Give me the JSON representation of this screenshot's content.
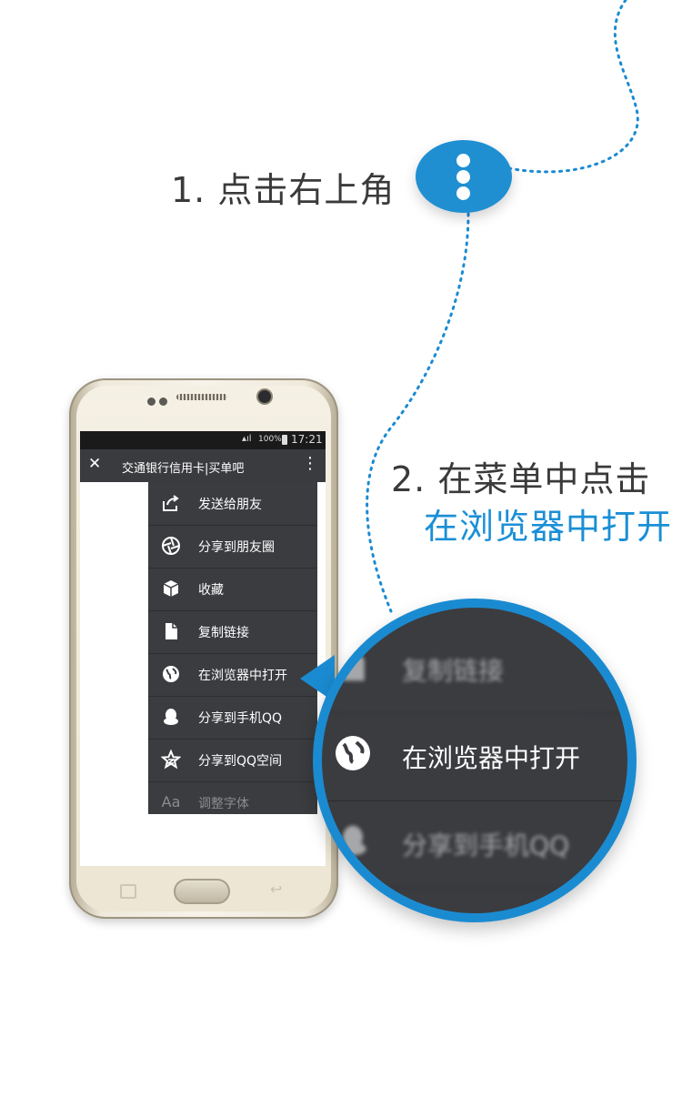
{
  "steps": {
    "step1": "1. 点击右上角",
    "step2_line1": "2. 在菜单中点击",
    "step2_line2": "在浏览器中打开"
  },
  "colors": {
    "accent": "#1b8bd1",
    "text": "#3a3a3a",
    "menu_bg": "#3b3c40"
  },
  "status_bar": {
    "battery": "100%",
    "time": "17:21"
  },
  "app_bar": {
    "close_icon": "close-icon",
    "title": "交通银行信用卡|买单吧",
    "more_icon": "more-vertical-icon"
  },
  "menu": {
    "items": [
      {
        "label": "发送给朋友",
        "icon": "share-icon"
      },
      {
        "label": "分享到朋友圈",
        "icon": "aperture-icon"
      },
      {
        "label": "收藏",
        "icon": "cube-icon"
      },
      {
        "label": "复制链接",
        "icon": "document-icon"
      },
      {
        "label": "在浏览器中打开",
        "icon": "globe-icon"
      },
      {
        "label": "分享到手机QQ",
        "icon": "qq-penguin-icon"
      },
      {
        "label": "分享到QQ空间",
        "icon": "qzone-star-icon"
      },
      {
        "label": "调整字体",
        "icon": "font-size-icon"
      }
    ]
  },
  "zoom": {
    "above": "复制链接",
    "highlight": "在浏览器中打开",
    "below": "分享到手机QQ"
  }
}
